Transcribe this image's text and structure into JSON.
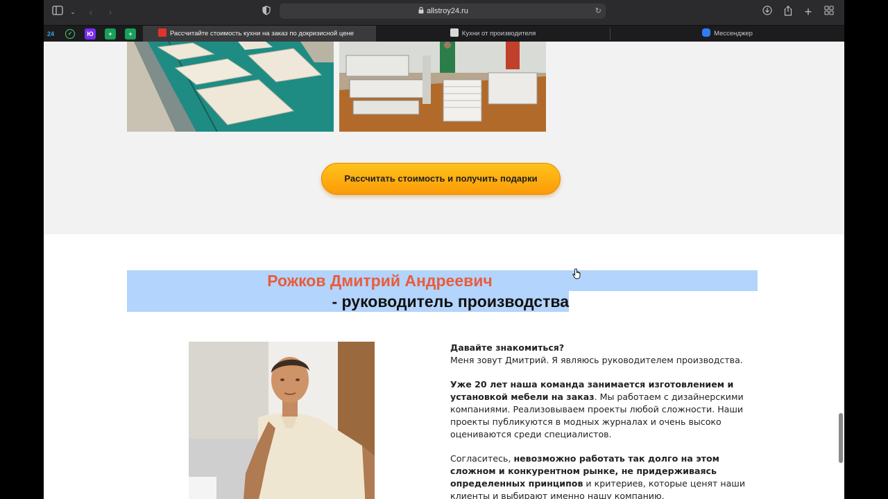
{
  "browser": {
    "url": "allstroy24.ru",
    "tabs": [
      {
        "title": "Рассчитайте стоимость кухни на заказ по докризисной цене",
        "active": true
      },
      {
        "title": "Кухни от производителя",
        "active": false
      },
      {
        "title": "Мессенджер",
        "active": false
      }
    ],
    "pinned": [
      "24",
      "✓",
      "Ю",
      "+",
      "+"
    ]
  },
  "section_top": {
    "cta_label": "Рассчитать стоимость и получить подарки"
  },
  "founder": {
    "name": "Рожков Дмитрий Андреевич",
    "role": "- руководитель производства"
  },
  "intro": {
    "p1_bold": "Давайте знакомиться?",
    "p1_text": "Меня зовут Дмитрий. Я являюсь руководителем производства.",
    "p2_bold": "Уже 20 лет наша команда занимается изготовлением и установкой мебели на заказ",
    "p2_text": ". Мы работаем с дизайнерскими компаниями. Реализовываем проекты любой сложности. Наши проекты публикуются в модных журналах и очень высоко оцениваются среди специалистов.",
    "p3_start": "Согласитесь, ",
    "p3_bold1": "невозможно работать так долго на этом сложном и конкурентном рынке, не придерживаясь определенных принципов",
    "p3_text": " и критериев, которые ценят наши клиенты и выбирают именно нашу компанию."
  },
  "colors": {
    "accent": "#e95c3b",
    "cta_from": "#ffc21a",
    "cta_to": "#fb9b08",
    "selection": "#b3d4fc"
  }
}
